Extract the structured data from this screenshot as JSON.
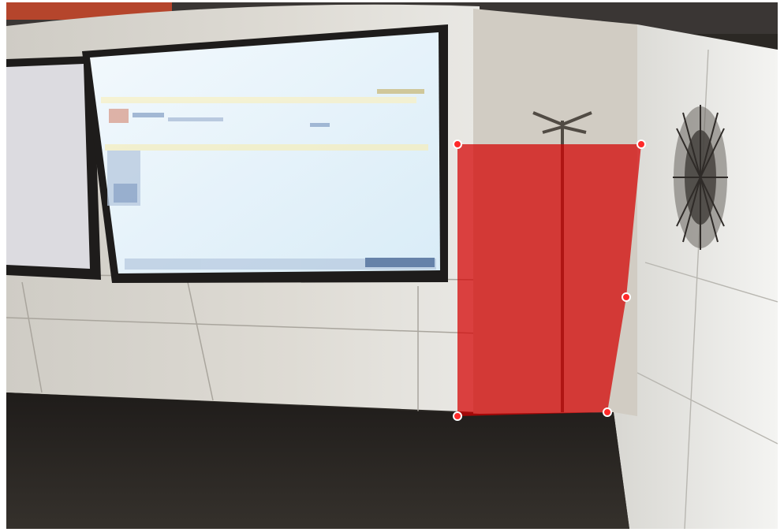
{
  "viewer": {
    "kind": "camera-frame-with-roi-overlay"
  },
  "roi": {
    "shape": "polygon",
    "fill_color": "#d40000",
    "fill_opacity": 0.72,
    "handle_color": "#ff2a2a",
    "handle_stroke": "#ffffff",
    "handle_count": 5
  },
  "scene": {
    "wall_color": "#d9d6cf",
    "floor_color": "#2a2622",
    "monitor_bezel": "#1e1c1b",
    "monitor_screen": "#e8f3fb",
    "ceiling_accent": "#b5452c"
  }
}
